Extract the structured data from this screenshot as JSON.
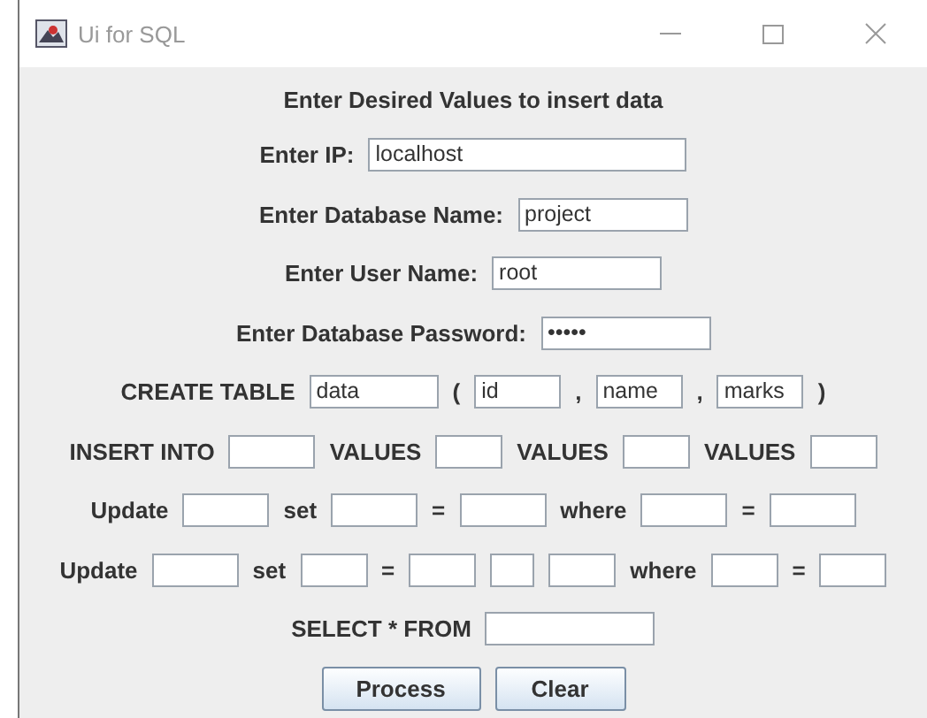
{
  "window": {
    "title": "Ui for SQL"
  },
  "heading": "Enter Desired Values to insert data",
  "rows": [
    {
      "items": [
        {
          "kind": "label",
          "text": "Enter IP:"
        },
        {
          "kind": "field",
          "value": "localhost"
        }
      ]
    },
    {
      "items": [
        {
          "kind": "label",
          "text": "Enter Database Name:"
        },
        {
          "kind": "field",
          "value": "project"
        }
      ]
    },
    {
      "items": [
        {
          "kind": "label",
          "text": "Enter User Name:"
        },
        {
          "kind": "field",
          "value": "root"
        }
      ]
    },
    {
      "items": [
        {
          "kind": "label",
          "text": "Enter Database Password:"
        },
        {
          "kind": "field",
          "value": "•••••"
        }
      ]
    },
    {
      "items": [
        {
          "kind": "label",
          "text": "CREATE TABLE"
        },
        {
          "kind": "field",
          "value": "data"
        },
        {
          "kind": "label",
          "text": "("
        },
        {
          "kind": "field",
          "value": "id"
        },
        {
          "kind": "label",
          "text": ","
        },
        {
          "kind": "field",
          "value": "name"
        },
        {
          "kind": "label",
          "text": ","
        },
        {
          "kind": "field",
          "value": "marks"
        },
        {
          "kind": "label",
          "text": ")"
        }
      ]
    },
    {
      "items": [
        {
          "kind": "label",
          "text": "INSERT INTO"
        },
        {
          "kind": "field"
        },
        {
          "kind": "label",
          "text": "VALUES"
        },
        {
          "kind": "field"
        },
        {
          "kind": "label",
          "text": "VALUES"
        },
        {
          "kind": "field"
        },
        {
          "kind": "label",
          "text": "VALUES"
        },
        {
          "kind": "field"
        }
      ]
    },
    {
      "items": [
        {
          "kind": "label",
          "text": "Update"
        },
        {
          "kind": "field"
        },
        {
          "kind": "label",
          "text": "set"
        },
        {
          "kind": "field"
        },
        {
          "kind": "label",
          "text": "="
        },
        {
          "kind": "field"
        },
        {
          "kind": "label",
          "text": "where"
        },
        {
          "kind": "field"
        },
        {
          "kind": "label",
          "text": "="
        },
        {
          "kind": "field"
        }
      ]
    },
    {
      "items": [
        {
          "kind": "label",
          "text": "Update"
        },
        {
          "kind": "field"
        },
        {
          "kind": "label",
          "text": "set"
        },
        {
          "kind": "field"
        },
        {
          "kind": "label",
          "text": "="
        },
        {
          "kind": "field"
        },
        {
          "kind": "field"
        },
        {
          "kind": "field"
        },
        {
          "kind": "label",
          "text": "where"
        },
        {
          "kind": "field"
        },
        {
          "kind": "label",
          "text": "="
        },
        {
          "kind": "field"
        }
      ]
    },
    {
      "items": [
        {
          "kind": "label",
          "text": "SELECT * FROM"
        },
        {
          "kind": "field"
        }
      ]
    }
  ],
  "buttons": [
    "Process",
    "Clear"
  ]
}
